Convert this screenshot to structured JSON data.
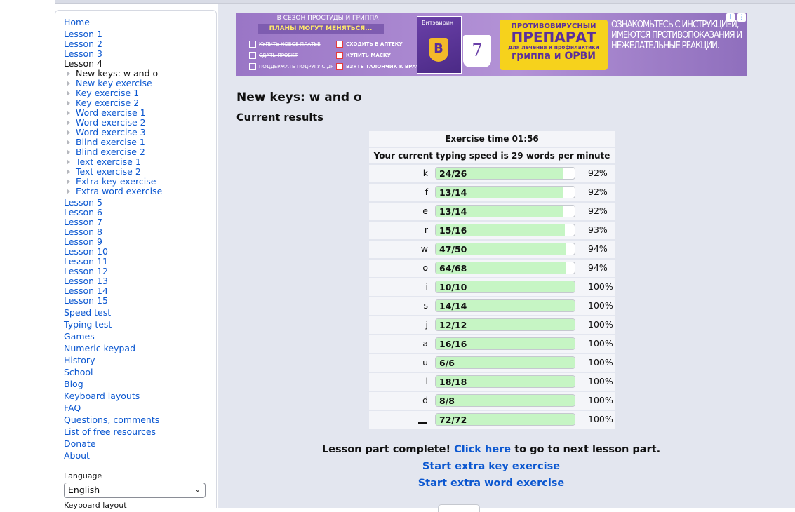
{
  "nav": {
    "top_links": [
      "Home",
      "Lesson 1",
      "Lesson 2",
      "Lesson 3"
    ],
    "current_lesson": "Lesson 4",
    "sub_items": [
      {
        "label": "New keys: w and o",
        "current": true
      },
      {
        "label": "New key exercise",
        "current": false
      },
      {
        "label": "Key exercise 1",
        "current": false
      },
      {
        "label": "Key exercise 2",
        "current": false
      },
      {
        "label": "Word exercise 1",
        "current": false
      },
      {
        "label": "Word exercise 2",
        "current": false
      },
      {
        "label": "Word exercise 3",
        "current": false
      },
      {
        "label": "Blind exercise 1",
        "current": false
      },
      {
        "label": "Blind exercise 2",
        "current": false
      },
      {
        "label": "Text exercise 1",
        "current": false
      },
      {
        "label": "Text exercise 2",
        "current": false
      },
      {
        "label": "Extra key exercise",
        "current": false
      },
      {
        "label": "Extra word exercise",
        "current": false
      }
    ],
    "more_lessons": [
      "Lesson 5",
      "Lesson 6",
      "Lesson 7",
      "Lesson 8",
      "Lesson 9",
      "Lesson 10",
      "Lesson 11",
      "Lesson 12",
      "Lesson 13",
      "Lesson 14",
      "Lesson 15"
    ],
    "other_links": [
      "Speed test",
      "Typing test",
      "Games",
      "Numeric keypad",
      "History",
      "School",
      "Blog",
      "Keyboard layouts",
      "FAQ",
      "Questions, comments",
      "List of free resources",
      "Donate",
      "About"
    ]
  },
  "language": {
    "label": "Language",
    "value": "English"
  },
  "keyboard_layout_label": "Keyboard layout",
  "ad": {
    "season_text": "В СЕЗОН ПРОСТУДЫ И ГРИППА",
    "plans_text": "ПЛАНЫ МОГУТ МЕНЯТЬСЯ...",
    "left_items": [
      "КУПИТЬ НОВОЕ ПЛАТЬЕ",
      "СДАТЬ ПРОЕКТ",
      "ПОДДЕРЖАТЬ ПОДРУГУ С ДР"
    ],
    "right_items": [
      "СХОДИТЬ В АПТЕКУ",
      "КУПИТЬ МАСКУ",
      "ВЗЯТЬ ТАЛОНЧИК К ВРАЧУ"
    ],
    "brand": "Витэвирин",
    "drug_line1": "ПРОТИВОВИРУСНЫЙ",
    "drug_line2": "ПРЕПАРАТ",
    "drug_line3": "для лечения и профилактики",
    "drug_line4": "гриппа и ОРВИ",
    "warning": "ОЗНАКОМЬТЕСЬ С ИНСТРУКЦИЕЙ, ИМЕЮТСЯ ПРОТИВОПОКАЗАНИЯ И НЕЖЕЛАТЕЛЬНЫЕ РЕАКЦИИ."
  },
  "page": {
    "title": "New keys: w and o",
    "subtitle": "Current results",
    "exercise_time": "Exercise time 01:56",
    "typing_speed": "Your current typing speed is 29 words per minute"
  },
  "results": [
    {
      "key": "k",
      "count": "24/26",
      "percent": "92%",
      "fill": 0.92
    },
    {
      "key": "f",
      "count": "13/14",
      "percent": "92%",
      "fill": 0.92
    },
    {
      "key": "e",
      "count": "13/14",
      "percent": "92%",
      "fill": 0.92
    },
    {
      "key": "r",
      "count": "15/16",
      "percent": "93%",
      "fill": 0.93
    },
    {
      "key": "w",
      "count": "47/50",
      "percent": "94%",
      "fill": 0.94
    },
    {
      "key": "o",
      "count": "64/68",
      "percent": "94%",
      "fill": 0.94
    },
    {
      "key": "i",
      "count": "10/10",
      "percent": "100%",
      "fill": 1.0
    },
    {
      "key": "s",
      "count": "14/14",
      "percent": "100%",
      "fill": 1.0
    },
    {
      "key": "j",
      "count": "12/12",
      "percent": "100%",
      "fill": 1.0
    },
    {
      "key": "a",
      "count": "16/16",
      "percent": "100%",
      "fill": 1.0
    },
    {
      "key": "u",
      "count": "6/6",
      "percent": "100%",
      "fill": 1.0
    },
    {
      "key": "l",
      "count": "18/18",
      "percent": "100%",
      "fill": 1.0
    },
    {
      "key": "d",
      "count": "8/8",
      "percent": "100%",
      "fill": 1.0
    },
    {
      "key": "",
      "count": "72/72",
      "percent": "100%",
      "fill": 1.0,
      "is_space": true
    }
  ],
  "completion": {
    "prefix": "Lesson part complete! ",
    "link": "Click here",
    "suffix": " to go to next lesson part.",
    "extra_key": "Start extra key exercise",
    "extra_word": "Start extra word exercise"
  },
  "colors": {
    "bar_fill": "#c6f5c4",
    "link": "#0b57d0",
    "main_bg": "#e3e6ef"
  }
}
